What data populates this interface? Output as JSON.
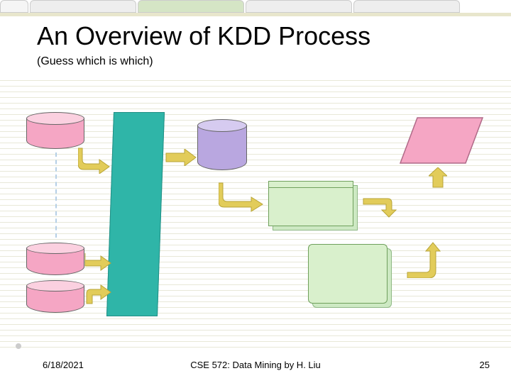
{
  "title": "An Overview of KDD Process",
  "subtitle": "(Guess which is which)",
  "footer": {
    "date": "6/18/2021",
    "center": "CSE 572: Data Mining by H. Liu",
    "page": "25"
  },
  "colors": {
    "pink_fill": "#f5a6c4",
    "pink_top": "#fbd0e0",
    "purple_fill": "#b9a7e0",
    "purple_top": "#d6cbf0",
    "teal": "#2fb5a8",
    "green_box": "#d9f0cc",
    "green_box_border": "#6fa05c",
    "arrow": "#e2cc5a"
  },
  "shapes": {
    "cyl_pink_1": "top-left-database",
    "cyl_pink_2": "middle-left-database",
    "cyl_pink_3": "bottom-left-database",
    "teal_shape": "data-warehouse",
    "cyl_purple": "cleaned-data",
    "green_box_1": "task-relevant-data",
    "green_box_2": "data-mining",
    "parallelogram": "pattern-evaluation"
  }
}
